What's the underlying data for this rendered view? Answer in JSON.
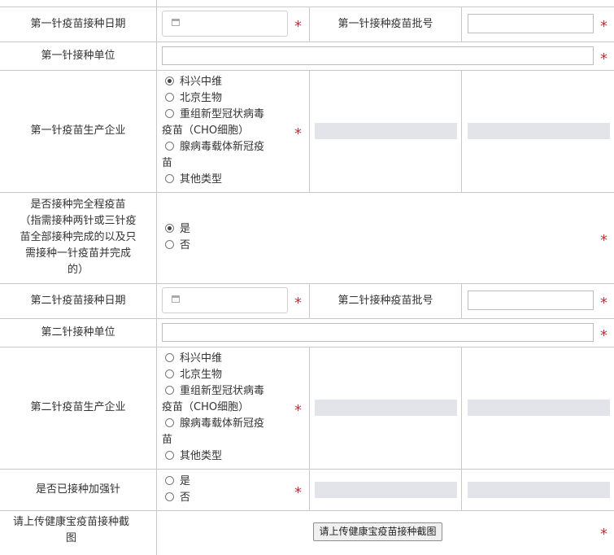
{
  "form": {
    "dose1": {
      "date_label": "第一针疫苗接种日期",
      "batch_label": "第一针接种疫苗批号",
      "unit_label": "第一针接种单位",
      "manufacturer_label": "第一针疫苗生产企业",
      "manufacturer_options": [
        {
          "label_1": "科兴中维",
          "label_2": "",
          "selected": true
        },
        {
          "label_1": "北京生物",
          "label_2": "",
          "selected": false
        },
        {
          "label_1": "重组新型冠状病毒",
          "label_2": "疫苗（CHO细胞）",
          "selected": false
        },
        {
          "label_1": "腺病毒载体新冠疫",
          "label_2": "苗",
          "selected": false
        },
        {
          "label_1": "其他类型",
          "label_2": "",
          "selected": false
        }
      ]
    },
    "full_course": {
      "label_lines": [
        "是否接种完全程疫苗",
        "（指需接种两针或三针疫",
        "苗全部接种完成的以及只",
        "需接种一针疫苗并完成",
        "的）"
      ],
      "options": [
        {
          "label": "是",
          "selected": true
        },
        {
          "label": "否",
          "selected": false
        }
      ]
    },
    "dose2": {
      "date_label": "第二针疫苗接种日期",
      "batch_label": "第二针接种疫苗批号",
      "unit_label": "第二针接种单位",
      "manufacturer_label": "第二针疫苗生产企业",
      "manufacturer_options": [
        {
          "label_1": "科兴中维",
          "label_2": "",
          "selected": false
        },
        {
          "label_1": "北京生物",
          "label_2": "",
          "selected": false
        },
        {
          "label_1": "重组新型冠状病毒",
          "label_2": "疫苗（CHO细胞）",
          "selected": false
        },
        {
          "label_1": "腺病毒载体新冠疫",
          "label_2": "苗",
          "selected": false
        },
        {
          "label_1": "其他类型",
          "label_2": "",
          "selected": false
        }
      ]
    },
    "booster": {
      "label": "是否已接种加强针",
      "options": [
        {
          "label": "是",
          "selected": false
        },
        {
          "label": "否",
          "selected": false
        }
      ]
    },
    "upload": {
      "label_lines": [
        "请上传健康宝疫苗接种截",
        "图"
      ],
      "button_label": "请上传健康宝疫苗接种截图"
    },
    "required_mark": "*"
  },
  "colors": {
    "required": "#b33a3a",
    "border": "#c8c8c8",
    "readonly_field": "#e2e4ea"
  },
  "icons": {
    "date_picker": "calendar-icon"
  }
}
